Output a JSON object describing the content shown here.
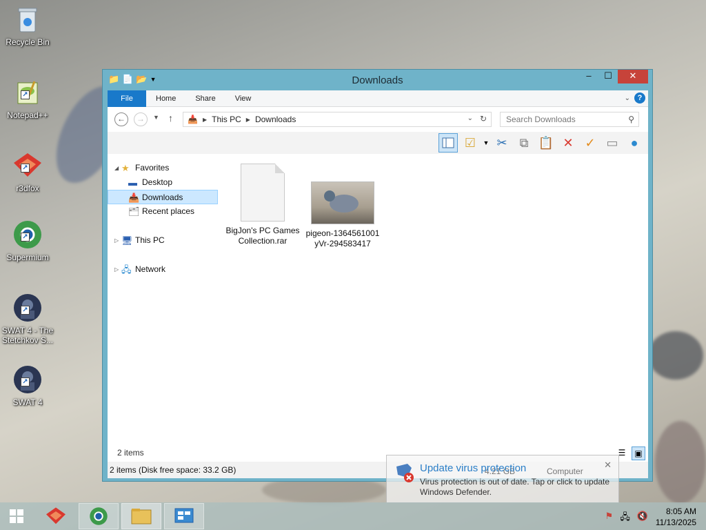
{
  "desktop": {
    "icons": [
      {
        "label": "Recycle Bin",
        "glyph": "🗑"
      },
      {
        "label": "Notepad++",
        "glyph": "📝"
      },
      {
        "label": "r3dfox",
        "glyph": "🦊"
      },
      {
        "label": "Supermium",
        "glyph": "🌐"
      },
      {
        "label": "SWAT 4 - The Stetchkov S...",
        "glyph": "🎮"
      },
      {
        "label": "SWAT 4",
        "glyph": "🎮"
      }
    ]
  },
  "window": {
    "title": "Downloads",
    "tabs": {
      "file": "File",
      "home": "Home",
      "share": "Share",
      "view": "View"
    },
    "address": {
      "back": "←",
      "forward": "→",
      "up": "↑",
      "crumbs": [
        "This PC",
        "Downloads"
      ],
      "search_placeholder": "Search Downloads"
    },
    "nav": {
      "favorites": "Favorites",
      "desktop": "Desktop",
      "downloads": "Downloads",
      "recent": "Recent places",
      "this_pc": "This PC",
      "network": "Network"
    },
    "files": [
      {
        "name": "BigJon's PC Games Collection.rar",
        "kind": "document"
      },
      {
        "name": "pigeon-1364561001yVr-294583417",
        "kind": "image"
      }
    ],
    "inner_status": "2 items",
    "statusbar": "2 items (Disk free space: 33.2 GB)"
  },
  "toast": {
    "title": "Update virus protection",
    "body": "Virus protection is out of date. Tap or click to update Windows Defender.",
    "ghost_size": "4.21 GB",
    "ghost_computer": "Computer"
  },
  "taskbar": {
    "time": "8:05 AM",
    "date": "11/13/2025"
  },
  "colors": {
    "accent": "#1979ca",
    "window_frame": "#6fb3c9",
    "close": "#c7433a",
    "selection": "#cce8ff"
  }
}
